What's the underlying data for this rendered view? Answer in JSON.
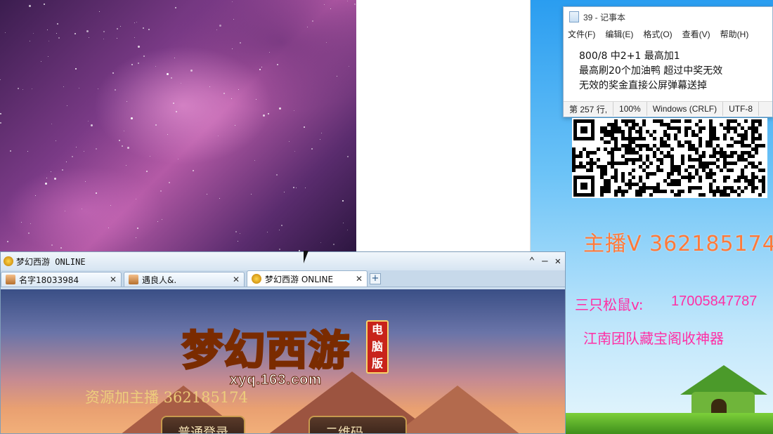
{
  "notepad": {
    "title": "39 - 记事本",
    "menu": [
      "文件(F)",
      "编辑(E)",
      "格式(O)",
      "查看(V)",
      "帮助(H)"
    ],
    "lines": [
      "800/8  中2+1 最高加1",
      "最高刷20个加油鸭  超过中奖无效",
      "无效的奖金直接公屏弹幕送掉"
    ],
    "status": {
      "position": "第 257 行,",
      "zoom": "100%",
      "line_ending": "Windows (CRLF)",
      "encoding": "UTF-8"
    }
  },
  "promo": {
    "anchor_line": "主播V 362185174",
    "squirrel_label": "三只松鼠v:",
    "squirrel_number": "17005847787",
    "team_line": "江南团队藏宝阁收神器"
  },
  "game_window": {
    "title": "梦幻西游 ONLINE",
    "controls": [
      "⌃",
      "–",
      "✕"
    ],
    "tabs": [
      {
        "label": "名字18033984",
        "active": false
      },
      {
        "label": "遇良人&.",
        "active": false
      },
      {
        "label": "梦幻西游 ONLINE",
        "active": true
      }
    ],
    "new_tab": "+",
    "logo_text": "梦幻西游",
    "edition": "电脑版",
    "site_url": "xyq.163.com",
    "overlay": "资源加主播 362185174",
    "buttons": [
      "普通登录",
      "二维码"
    ]
  },
  "colors": {
    "promo_orange": "#ff7a3a",
    "promo_pink": "#ff2fa4",
    "desktop_blue": "#2a9df0"
  }
}
